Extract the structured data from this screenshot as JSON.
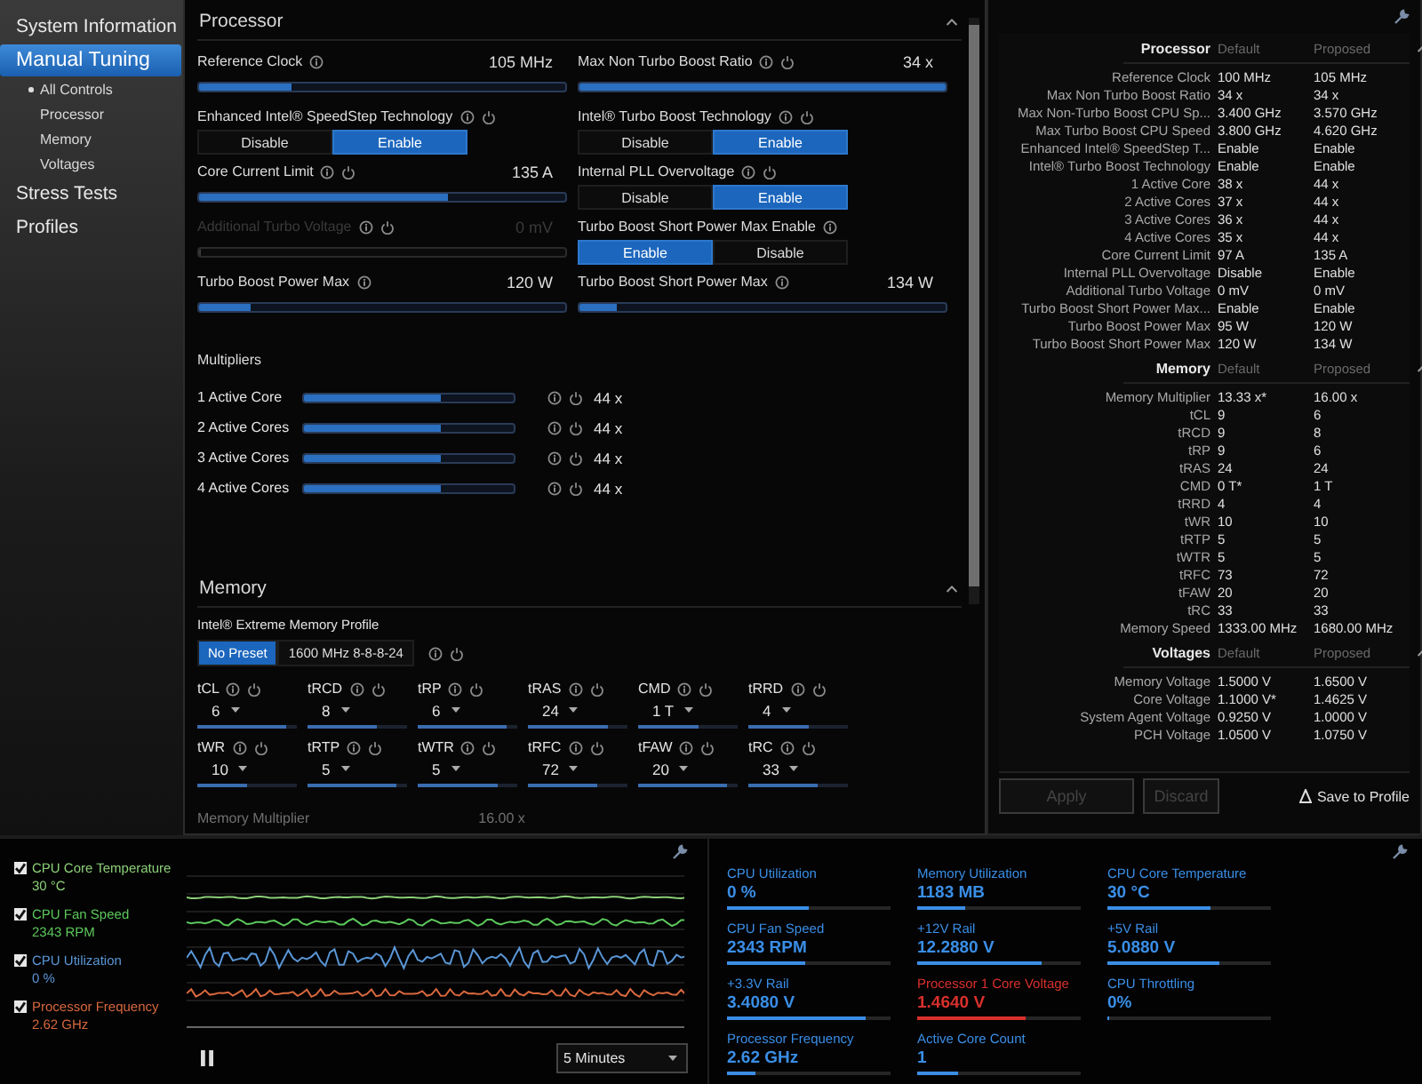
{
  "sidebar": {
    "items": [
      {
        "label": "System Information",
        "selected": false
      },
      {
        "label": "Manual Tuning",
        "selected": true,
        "children": [
          {
            "label": "All Controls",
            "selected": true
          },
          {
            "label": "Processor",
            "selected": false
          },
          {
            "label": "Memory",
            "selected": false
          },
          {
            "label": "Voltages",
            "selected": false
          }
        ]
      },
      {
        "label": "Stress Tests",
        "selected": false
      },
      {
        "label": "Profiles",
        "selected": false
      }
    ]
  },
  "processor": {
    "title": "Processor",
    "left_controls": [
      {
        "kind": "slider",
        "label": "Reference Clock",
        "value": "105 MHz",
        "level": 0.25,
        "reset": false,
        "disabled": false
      },
      {
        "kind": "toggle",
        "label": "Enhanced Intel® SpeedStep Technology",
        "reset": true,
        "options": [
          {
            "label": "Disable",
            "selected": false
          },
          {
            "label": "Enable",
            "selected": true
          }
        ]
      },
      {
        "kind": "slider",
        "label": "Core Current Limit",
        "value": "135 A",
        "level": 0.68,
        "reset": true,
        "disabled": false
      },
      {
        "kind": "slider",
        "label": "Additional Turbo Voltage",
        "value": "0 mV",
        "level": 0,
        "reset": true,
        "disabled": true
      },
      {
        "kind": "slider",
        "label": "Turbo Boost Power Max",
        "value": "120 W",
        "level": 0.14,
        "reset": false,
        "disabled": false
      }
    ],
    "right_controls": [
      {
        "kind": "slider",
        "label": "Max Non Turbo Boost Ratio",
        "value": "34 x",
        "level": 1.0,
        "reset": true,
        "disabled": false
      },
      {
        "kind": "toggle",
        "label": "Intel® Turbo Boost Technology",
        "reset": true,
        "options": [
          {
            "label": "Disable",
            "selected": false
          },
          {
            "label": "Enable",
            "selected": true
          }
        ]
      },
      {
        "kind": "toggle",
        "label": "Internal PLL Overvoltage",
        "reset": true,
        "options": [
          {
            "label": "Disable",
            "selected": false
          },
          {
            "label": "Enable",
            "selected": true
          }
        ]
      },
      {
        "kind": "toggle",
        "label": "Turbo Boost Short Power Max Enable",
        "reset": false,
        "options": [
          {
            "label": "Enable",
            "selected": true
          },
          {
            "label": "Disable",
            "selected": false
          }
        ]
      },
      {
        "kind": "slider",
        "label": "Turbo Boost Short Power Max",
        "value": "134 W",
        "level": 0.1,
        "reset": false,
        "disabled": false
      }
    ]
  },
  "multipliers": {
    "title": "Multipliers",
    "rows": [
      {
        "label": "1 Active Core",
        "value": "44 x",
        "level": 0.65
      },
      {
        "label": "2 Active Cores",
        "value": "44 x",
        "level": 0.65
      },
      {
        "label": "3 Active Cores",
        "value": "44 x",
        "level": 0.65
      },
      {
        "label": "4 Active Cores",
        "value": "44 x",
        "level": 0.65
      }
    ]
  },
  "memory": {
    "title": "Memory",
    "xmp_label": "Intel® Extreme Memory Profile",
    "presets": [
      {
        "label": "No Preset",
        "selected": true
      },
      {
        "label": "1600 MHz 8-8-8-24",
        "selected": false
      }
    ],
    "timings": [
      {
        "label": "tCL",
        "value": "6",
        "level": 0.9
      },
      {
        "label": "tRCD",
        "value": "8",
        "level": 0.7
      },
      {
        "label": "tRP",
        "value": "6",
        "level": 0.9
      },
      {
        "label": "tRAS",
        "value": "24",
        "level": 0.8
      },
      {
        "label": "CMD",
        "value": "1 T",
        "level": 0.6
      },
      {
        "label": "tRRD",
        "value": "4",
        "level": 0.6
      },
      {
        "label": "tWR",
        "value": "10",
        "level": 0.5
      },
      {
        "label": "tRTP",
        "value": "5",
        "level": 0.9
      },
      {
        "label": "tWTR",
        "value": "5",
        "level": 0.8
      },
      {
        "label": "tRFC",
        "value": "72",
        "level": 0.7
      },
      {
        "label": "tFAW",
        "value": "20",
        "level": 0.9
      },
      {
        "label": "tRC",
        "value": "33",
        "level": 0.7
      }
    ],
    "next_row": {
      "label": "Memory Multiplier",
      "value": "16.00 x"
    }
  },
  "summary": {
    "sections": [
      {
        "title": "Processor",
        "default_heading": "Default",
        "proposed_heading": "Proposed",
        "rows": [
          {
            "name": "Reference Clock",
            "default": "100 MHz",
            "proposed": "105 MHz"
          },
          {
            "name": "Max Non Turbo Boost Ratio",
            "default": "34 x",
            "proposed": "34 x"
          },
          {
            "name": "Max Non-Turbo Boost CPU Sp...",
            "default": "3.400 GHz",
            "proposed": "3.570 GHz"
          },
          {
            "name": "Max Turbo Boost CPU Speed",
            "default": "3.800 GHz",
            "proposed": "4.620 GHz"
          },
          {
            "name": "Enhanced Intel® SpeedStep T...",
            "default": "Enable",
            "proposed": "Enable"
          },
          {
            "name": "Intel® Turbo Boost Technology",
            "default": "Enable",
            "proposed": "Enable"
          },
          {
            "name": "1 Active Core",
            "default": "38 x",
            "proposed": "44 x"
          },
          {
            "name": "2 Active Cores",
            "default": "37 x",
            "proposed": "44 x"
          },
          {
            "name": "3 Active Cores",
            "default": "36 x",
            "proposed": "44 x"
          },
          {
            "name": "4 Active Cores",
            "default": "35 x",
            "proposed": "44 x"
          },
          {
            "name": "Core Current Limit",
            "default": "97 A",
            "proposed": "135 A"
          },
          {
            "name": "Internal PLL Overvoltage",
            "default": "Disable",
            "proposed": "Enable"
          },
          {
            "name": "Additional Turbo Voltage",
            "default": "0 mV",
            "proposed": "0 mV"
          },
          {
            "name": "Turbo Boost Short Power Max...",
            "default": "Enable",
            "proposed": "Enable"
          },
          {
            "name": "Turbo Boost Power Max",
            "default": "95 W",
            "proposed": "120 W"
          },
          {
            "name": "Turbo Boost Short Power Max",
            "default": "120 W",
            "proposed": "134 W"
          }
        ]
      },
      {
        "title": "Memory",
        "default_heading": "Default",
        "proposed_heading": "Proposed",
        "rows": [
          {
            "name": "Memory Multiplier",
            "default": "13.33 x*",
            "proposed": "16.00 x"
          },
          {
            "name": "tCL",
            "default": "9",
            "proposed": "6"
          },
          {
            "name": "tRCD",
            "default": "9",
            "proposed": "8"
          },
          {
            "name": "tRP",
            "default": "9",
            "proposed": "6"
          },
          {
            "name": "tRAS",
            "default": "24",
            "proposed": "24"
          },
          {
            "name": "CMD",
            "default": "0 T*",
            "proposed": "1 T"
          },
          {
            "name": "tRRD",
            "default": "4",
            "proposed": "4"
          },
          {
            "name": "tWR",
            "default": "10",
            "proposed": "10"
          },
          {
            "name": "tRTP",
            "default": "5",
            "proposed": "5"
          },
          {
            "name": "tWTR",
            "default": "5",
            "proposed": "5"
          },
          {
            "name": "tRFC",
            "default": "73",
            "proposed": "72"
          },
          {
            "name": "tFAW",
            "default": "20",
            "proposed": "20"
          },
          {
            "name": "tRC",
            "default": "33",
            "proposed": "33"
          },
          {
            "name": "Memory Speed",
            "default": "1333.00 MHz",
            "proposed": "1680.00 MHz"
          }
        ]
      },
      {
        "title": "Voltages",
        "default_heading": "Default",
        "proposed_heading": "Proposed",
        "rows": [
          {
            "name": "Memory Voltage",
            "default": "1.5000 V",
            "proposed": "1.6500 V"
          },
          {
            "name": "Core Voltage",
            "default": "1.1000 V*",
            "proposed": "1.4625 V"
          },
          {
            "name": "System Agent Voltage",
            "default": "0.9250 V",
            "proposed": "1.0000 V"
          },
          {
            "name": "PCH Voltage",
            "default": "1.0500 V",
            "proposed": "1.0750 V"
          }
        ]
      }
    ],
    "buttons": [
      {
        "label": "Apply",
        "disabled": true
      },
      {
        "label": "Discard",
        "disabled": true
      }
    ],
    "save_label": "Save to Profile"
  },
  "monitors": {
    "items": [
      {
        "label": "CPU Core Temperature",
        "value": "30 °C",
        "checked": true,
        "color": "#8ccf78"
      },
      {
        "label": "CPU Fan Speed",
        "value": "2343 RPM",
        "checked": true,
        "color": "#5cc85c"
      },
      {
        "label": "CPU Utilization",
        "value": "0 %",
        "checked": true,
        "color": "#5a96d6"
      },
      {
        "label": "Processor Frequency",
        "value": "2.62 GHz",
        "checked": true,
        "color": "#d8683e"
      }
    ],
    "interval": "5 Minutes"
  },
  "meters": [
    {
      "label": "CPU Utilization",
      "value": "0 %",
      "level": 0.5,
      "color": "#3a8ee6"
    },
    {
      "label": "Memory Utilization",
      "value": "1183 MB",
      "level": 0.29,
      "color": "#3a8ee6"
    },
    {
      "label": "CPU Core Temperature",
      "value": "30 °C",
      "level": 0.63,
      "color": "#3a8ee6"
    },
    {
      "label": "CPU Fan Speed",
      "value": "2343 RPM",
      "level": 0.48,
      "color": "#3a8ee6"
    },
    {
      "label": "+12V Rail",
      "value": "12.2880 V",
      "level": 0.76,
      "color": "#3a8ee6"
    },
    {
      "label": "+5V Rail",
      "value": "5.0880 V",
      "level": 0.69,
      "color": "#3a8ee6"
    },
    {
      "label": "+3.3V Rail",
      "value": "3.4080 V",
      "level": 0.85,
      "color": "#3a8ee6"
    },
    {
      "label": "Processor 1 Core Voltage",
      "value": "1.4640 V",
      "level": 0.66,
      "color": "#d9302c"
    },
    {
      "label": "CPU Throttling",
      "value": "0%",
      "level": 0,
      "color": "#3a8ee6"
    },
    {
      "label": "Processor Frequency",
      "value": "2.62 GHz",
      "level": 0.17,
      "color": "#3a8ee6"
    },
    {
      "label": "Active Core Count",
      "value": "1",
      "level": 0.25,
      "color": "#3a8ee6"
    }
  ]
}
